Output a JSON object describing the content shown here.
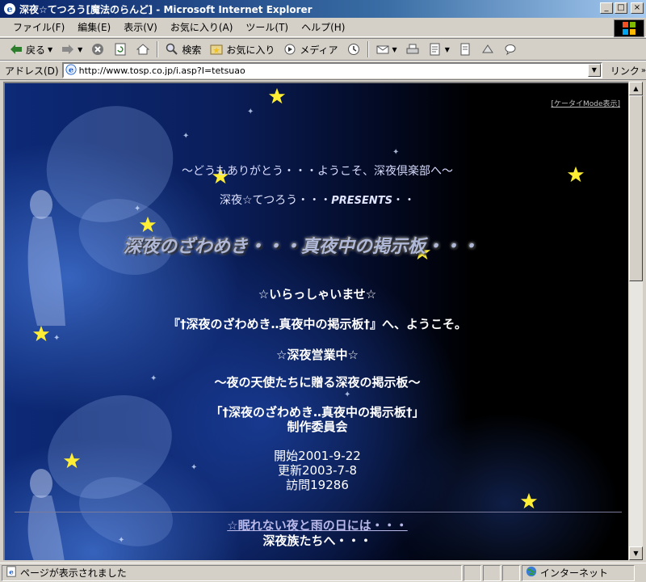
{
  "window": {
    "title": "深夜☆てつろう[魔法のらんど] - Microsoft Internet Explorer",
    "minimize": "_",
    "maximize": "□",
    "close": "×"
  },
  "menu": {
    "items": [
      {
        "label": "ファイル(F)"
      },
      {
        "label": "編集(E)"
      },
      {
        "label": "表示(V)"
      },
      {
        "label": "お気に入り(A)"
      },
      {
        "label": "ツール(T)"
      },
      {
        "label": "ヘルプ(H)"
      }
    ]
  },
  "toolbar": {
    "back": "戻る",
    "search": "検索",
    "favorites": "お気に入り",
    "media": "メディア"
  },
  "address": {
    "label": "アドレス(D)",
    "url": "http://www.tosp.co.jp/i.asp?I=tetsuao",
    "links": "リンク"
  },
  "page": {
    "ketai_link": "[ケータイMode表示]",
    "greeting": "～どうもありがとう・・・ようこそ、深夜倶楽部へ～",
    "presents_name": "深夜☆てつろう・・・",
    "presents_word": "PRESENTS",
    "presents_tail": "・・",
    "big_title": "深夜のざわめき・・・真夜中の掲示板・・・",
    "welcome": "☆いらっしゃいませ☆",
    "intro": "『†深夜のざわめき‥真夜中の掲示板†』へ、ようこそ。",
    "open": "☆深夜営業中☆",
    "tagline": "～夜の天使たちに贈る深夜の掲示板～",
    "committee_line1": "「†深夜のざわめき‥真夜中の掲示板†」",
    "committee_line2": "制作委員会",
    "start": "開始2001-9-22",
    "update": "更新2003-7-8",
    "visits": "訪問19286",
    "sleepless": "☆眠れない夜と雨の日には・・・",
    "tribe": "深夜族たちへ・・・"
  },
  "status": {
    "text": "ページが表示されました",
    "zone": "インターネット"
  },
  "colors": {
    "star": "#ffee33",
    "title_bar_start": "#0a246a",
    "title_bar_end": "#a6caf0"
  },
  "icons": {
    "back": "arrow-left-icon",
    "forward": "arrow-right-icon",
    "stop": "stop-icon",
    "refresh": "refresh-icon",
    "home": "home-icon",
    "search": "search-icon",
    "favorites": "favorites-icon",
    "media": "media-icon",
    "history": "history-icon",
    "mail": "mail-icon",
    "print": "print-icon",
    "edit": "edit-icon",
    "discuss": "discuss-icon",
    "messenger": "messenger-icon",
    "page": "ie-page-icon",
    "globe": "globe-icon"
  }
}
